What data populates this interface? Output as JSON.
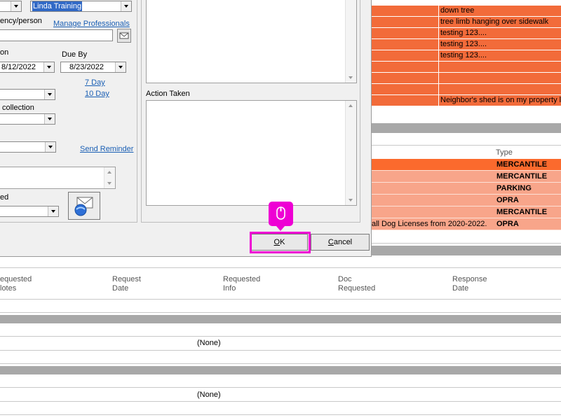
{
  "dialog": {
    "assignee_value": "Linda Training",
    "agency_label": "ency/person",
    "manage_professionals_link": "Manage Professionals",
    "date_label_left": "on",
    "due_by_label": "Due By",
    "date_left_value": "8/12/2022",
    "due_by_value": "8/23/2022",
    "seven_day_link": "7 Day",
    "ten_day_link": "10 Day",
    "collection_label": "collection",
    "send_reminder_link": "Send Reminder",
    "ed_label": "ed",
    "action_taken_label": "Action Taken",
    "ok_label_prefix": "",
    "ok_label_u": "O",
    "ok_label_rest": "K",
    "cancel_label_u": "C",
    "cancel_label_rest": "ancel"
  },
  "background": {
    "orange_rows": [
      {
        "text": "down tree"
      },
      {
        "text": "tree limb hanging over sidewalk"
      },
      {
        "text": "testing 123...."
      },
      {
        "text": "testing 123...."
      },
      {
        "text": "testing 123...."
      },
      {
        "text": ""
      },
      {
        "text": ""
      },
      {
        "text": ""
      },
      {
        "text": "Neighbor's shed is on my property li"
      }
    ],
    "type_header": "Type",
    "salmon_rows": [
      {
        "type": "MERCANTILE",
        "text": ""
      },
      {
        "type": "MERCANTILE",
        "text": ""
      },
      {
        "type": "PARKING",
        "text": ""
      },
      {
        "type": "OPRA",
        "text": ""
      },
      {
        "type": "MERCANTILE",
        "text": ""
      },
      {
        "type": "OPRA",
        "text": "all Dog Licenses from 2020-2022."
      }
    ],
    "columns": [
      {
        "line1": "equested",
        "line2": "lotes"
      },
      {
        "line1": "Request",
        "line2": "Date"
      },
      {
        "line1": "Requested",
        "line2": "Info"
      },
      {
        "line1": "Doc",
        "line2": "Requested"
      },
      {
        "line1": "Response",
        "line2": "Date"
      }
    ],
    "none_1": "(None)",
    "none_2": "(None)"
  },
  "colors": {
    "orange": "#f26b3a",
    "salmon": "#f8a58a",
    "highlight": "#ee00d4"
  }
}
